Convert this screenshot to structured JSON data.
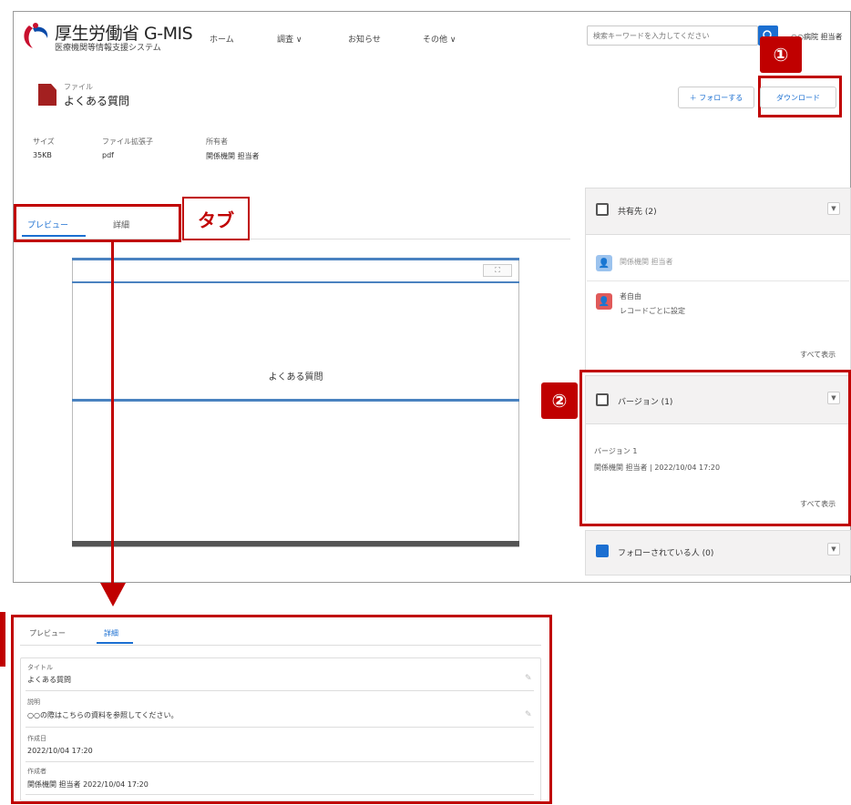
{
  "header": {
    "logo_title": "厚生労働省 G-MIS",
    "logo_subtitle": "医療機関等情報支援システム",
    "nav": [
      "ホーム",
      "調査 ∨",
      "お知らせ",
      "その他 ∨"
    ],
    "search_placeholder": "検索キーワードを入力してください",
    "user_name": "○○病院 担当者"
  },
  "file": {
    "type_label": "ファイル",
    "name": "よくある質問",
    "follow_button": "＋ フォローする",
    "download_button": "ダウンロード",
    "meta": [
      {
        "label": "サイズ",
        "value": "35KB"
      },
      {
        "label": "ファイル拡張子",
        "value": "pdf"
      },
      {
        "label": "所有者",
        "value": "関係機関 担当者"
      }
    ]
  },
  "tabs": {
    "preview": "プレビュー",
    "detail": "詳細",
    "callout": "タブ"
  },
  "preview": {
    "title": "よくある質問",
    "expand": "⛶"
  },
  "callouts": {
    "one": "①",
    "two": "②"
  },
  "panels": {
    "share": {
      "title": "共有先 (2)",
      "rows": [
        {
          "name": "関係機関 担当者",
          "sub": ""
        },
        {
          "name": "者自由",
          "sub": "レコードごとに設定"
        }
      ],
      "show_all": "すべて表示"
    },
    "version": {
      "title": "バージョン (1)",
      "item_title": "バージョン 1",
      "item_sub": "関係機関 担当者 | 2022/10/04 17:20",
      "show_all": "すべて表示"
    },
    "followers": {
      "title": "フォローされている人 (0)"
    }
  },
  "detail": {
    "tab_preview": "プレビュー",
    "tab_detail": "詳細",
    "fields": [
      {
        "label": "タイトル",
        "value": "よくある質問"
      },
      {
        "label": "説明",
        "value": "○○の際はこちらの資料を参照してください。"
      },
      {
        "label": "作成日",
        "value": "2022/10/04 17:20"
      },
      {
        "label": "作成者",
        "value": "関係機関 担当者  2022/10/04 17:20"
      }
    ]
  },
  "colors": {
    "accent": "#1b6fd1",
    "callout": "#c00000"
  }
}
